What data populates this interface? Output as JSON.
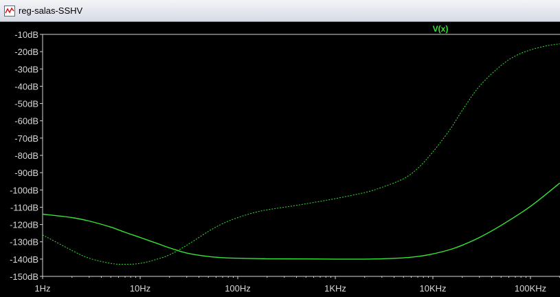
{
  "window": {
    "title": "reg-salas-SSHV",
    "icon": "waveform-window-icon"
  },
  "colors": {
    "background": "#000000",
    "frame": "#d8d8d8",
    "trace": "#36e536",
    "trace_dotted": "#36e536"
  },
  "chart_data": {
    "type": "line",
    "legend": [
      "V(x)"
    ],
    "legend_placement": "top-center-right",
    "x_scale": "log",
    "xlim": [
      1,
      200000
    ],
    "ylim": [
      -150,
      -10
    ],
    "grid": false,
    "x_ticks": [
      {
        "value": 1,
        "label": "1Hz"
      },
      {
        "value": 10,
        "label": "10Hz"
      },
      {
        "value": 100,
        "label": "100Hz"
      },
      {
        "value": 1000,
        "label": "1KHz"
      },
      {
        "value": 10000,
        "label": "10KHz"
      },
      {
        "value": 100000,
        "label": "100KHz"
      }
    ],
    "y_ticks": [
      {
        "value": -10,
        "label": "-10dB"
      },
      {
        "value": -20,
        "label": "-20dB"
      },
      {
        "value": -30,
        "label": "-30dB"
      },
      {
        "value": -40,
        "label": "-40dB"
      },
      {
        "value": -50,
        "label": "-50dB"
      },
      {
        "value": -60,
        "label": "-60dB"
      },
      {
        "value": -70,
        "label": "-70dB"
      },
      {
        "value": -80,
        "label": "-80dB"
      },
      {
        "value": -90,
        "label": "-90dB"
      },
      {
        "value": -100,
        "label": "-100dB"
      },
      {
        "value": -110,
        "label": "-110dB"
      },
      {
        "value": -120,
        "label": "-120dB"
      },
      {
        "value": -130,
        "label": "-130dB"
      },
      {
        "value": -140,
        "label": "-140dB"
      },
      {
        "value": -150,
        "label": "-150dB"
      }
    ],
    "series": [
      {
        "style": "solid",
        "x": [
          1,
          2,
          3,
          5,
          7,
          10,
          15,
          20,
          30,
          50,
          70,
          100,
          200,
          500,
          1000,
          2000,
          3000,
          5000,
          7000,
          10000,
          15000,
          20000,
          30000,
          50000,
          100000,
          200000
        ],
        "y": [
          -114,
          -116,
          -118,
          -121.5,
          -124.5,
          -127.5,
          -131,
          -133.5,
          -136.5,
          -138.5,
          -139.2,
          -139.5,
          -139.8,
          -139.9,
          -140,
          -140,
          -139.8,
          -139.3,
          -138.5,
          -137,
          -134.5,
          -132,
          -127.5,
          -120.5,
          -109.5,
          -96
        ]
      },
      {
        "style": "dotted",
        "x": [
          1,
          2,
          3,
          5,
          7,
          10,
          15,
          20,
          30,
          50,
          70,
          100,
          150,
          200,
          300,
          500,
          1000,
          2000,
          3000,
          5000,
          7000,
          10000,
          15000,
          20000,
          30000,
          50000,
          70000,
          100000,
          150000,
          200000
        ],
        "y": [
          -126,
          -135,
          -139.5,
          -142.5,
          -143,
          -142.5,
          -140,
          -137.5,
          -132,
          -124,
          -119.5,
          -116,
          -113,
          -111.5,
          -110,
          -108,
          -105,
          -101.5,
          -98.5,
          -93.5,
          -87.5,
          -78,
          -65,
          -54,
          -40,
          -28,
          -22.5,
          -19,
          -16.5,
          -15.5
        ]
      }
    ]
  }
}
